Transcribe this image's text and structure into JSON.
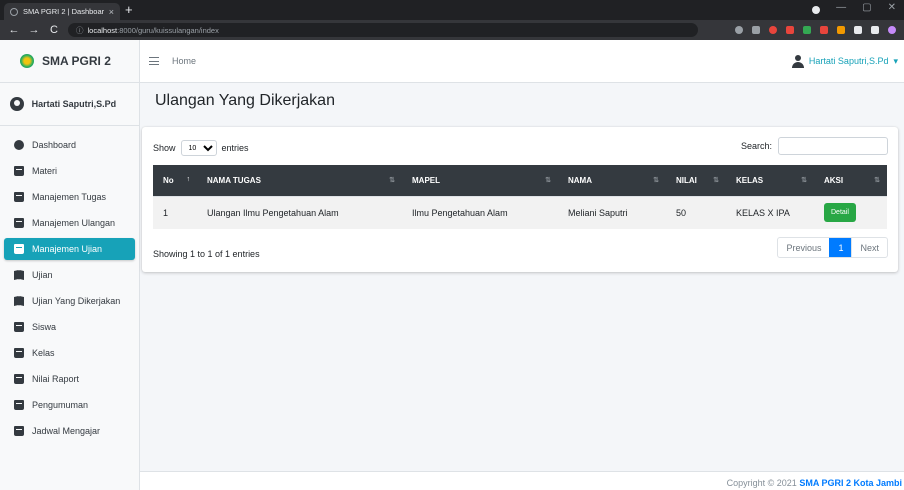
{
  "browser": {
    "tab_title": "SMA PGRI 2 | Dashboard",
    "tab_close": "×",
    "new_tab": "+",
    "url_host": "localhost",
    "url_path": ":8000/guru/kuissulangan/index",
    "back": "←",
    "forward": "→",
    "reload": "C",
    "info_icon": "ⓘ"
  },
  "sidebar": {
    "brand": "SMA PGRI 2",
    "user": "Hartati Saputri,S.Pd",
    "items": [
      {
        "label": "Dashboard",
        "icon": "dashboard-icon"
      },
      {
        "label": "Materi",
        "icon": "book-icon"
      },
      {
        "label": "Manajemen Tugas",
        "icon": "book-icon"
      },
      {
        "label": "Manajemen Ulangan",
        "icon": "book-icon"
      },
      {
        "label": "Manajemen Ujian",
        "icon": "book-icon"
      },
      {
        "label": "Ujian",
        "icon": "book-open-icon"
      },
      {
        "label": "Ujian Yang Dikerjakan",
        "icon": "book-open-icon"
      },
      {
        "label": "Siswa",
        "icon": "book-icon"
      },
      {
        "label": "Kelas",
        "icon": "book-icon"
      },
      {
        "label": "Nilai Raport",
        "icon": "book-icon"
      },
      {
        "label": "Pengumuman",
        "icon": "book-icon"
      },
      {
        "label": "Jadwal Mengajar",
        "icon": "book-icon"
      }
    ],
    "active_index": 4
  },
  "topnav": {
    "home": "Home",
    "user": "Hartati Saputri,S.Pd",
    "caret": "▾"
  },
  "main": {
    "title": "Ulangan Yang Dikerjakan",
    "show_label": "Show",
    "entries_label": "entries",
    "length_value": "10",
    "search_label": "Search:",
    "columns": [
      "No",
      "NAMA TUGAS",
      "MAPEL",
      "NAMA",
      "NILAI",
      "KELAS",
      "AKSI"
    ],
    "rows": [
      {
        "no": "1",
        "tugas": "Ulangan Ilmu Pengetahuan Alam",
        "mapel": "Ilmu Pengetahuan Alam",
        "nama": "Meliani Saputri",
        "nilai": "50",
        "kelas": "KELAS X IPA",
        "aksi": "Detail"
      }
    ],
    "info": "Showing 1 to 1 of 1 entries",
    "pager": {
      "previous": "Previous",
      "current": "1",
      "next": "Next"
    }
  },
  "footer": {
    "prefix": "Copyright © 2021",
    "brand": "SMA PGRI 2 Kota Jambi"
  },
  "colors": {
    "accent": "#17a2b8",
    "header_dark": "#343a40",
    "detail_button": "#28a745",
    "pager_active": "#007bff"
  }
}
